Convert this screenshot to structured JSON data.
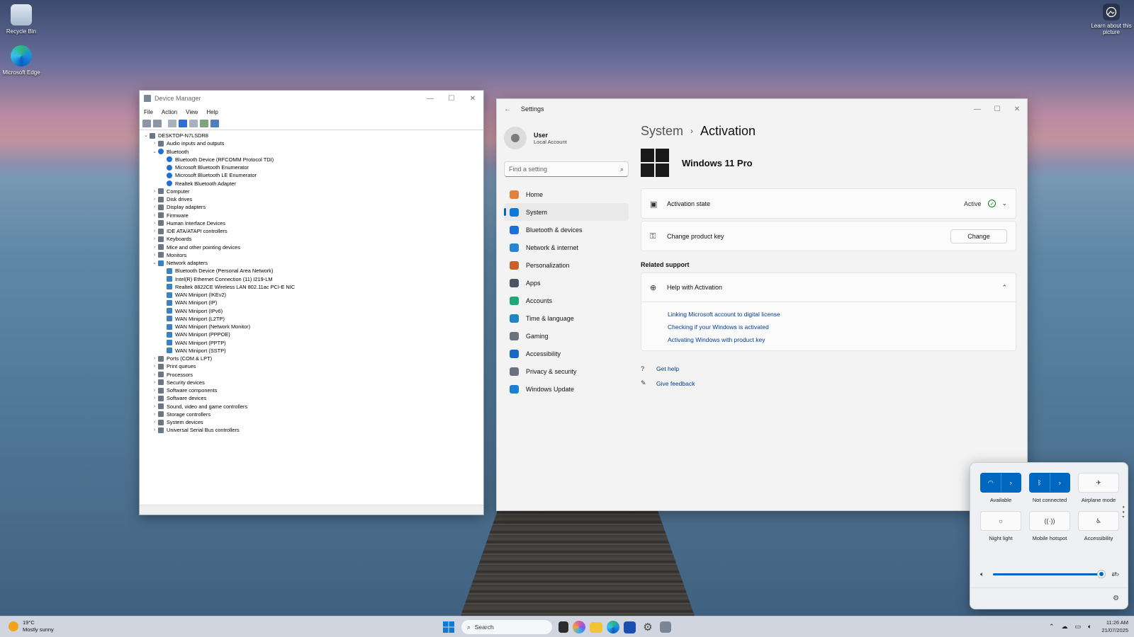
{
  "desktop": {
    "icons": [
      {
        "label": "Recycle Bin",
        "icon": "recycle-bin-icon"
      },
      {
        "label": "Microsoft Edge",
        "icon": "edge-icon"
      }
    ],
    "learn_label": "Learn about this picture"
  },
  "device_manager": {
    "title": "Device Manager",
    "menu": [
      "File",
      "Action",
      "View",
      "Help"
    ],
    "tree": [
      {
        "label": "DESKTOP-N7LSDR8",
        "level": 0,
        "expanded": true
      },
      {
        "label": "Audio inputs and outputs",
        "level": 1,
        "expanded": false
      },
      {
        "label": "Bluetooth",
        "level": 1,
        "expanded": true,
        "icon": "bt"
      },
      {
        "label": "Bluetooth Device (RFCOMM Protocol TDI)",
        "level": 2,
        "icon": "bt"
      },
      {
        "label": "Microsoft Bluetooth Enumerator",
        "level": 2,
        "icon": "bt"
      },
      {
        "label": "Microsoft Bluetooth LE Enumerator",
        "level": 2,
        "icon": "bt"
      },
      {
        "label": "Realtek Bluetooth Adapter",
        "level": 2,
        "icon": "bt"
      },
      {
        "label": "Computer",
        "level": 1,
        "expanded": false
      },
      {
        "label": "Disk drives",
        "level": 1,
        "expanded": false
      },
      {
        "label": "Display adapters",
        "level": 1,
        "expanded": false
      },
      {
        "label": "Firmware",
        "level": 1,
        "expanded": false
      },
      {
        "label": "Human Interface Devices",
        "level": 1,
        "expanded": false
      },
      {
        "label": "IDE ATA/ATAPI controllers",
        "level": 1,
        "expanded": false
      },
      {
        "label": "Keyboards",
        "level": 1,
        "expanded": false
      },
      {
        "label": "Mice and other pointing devices",
        "level": 1,
        "expanded": false
      },
      {
        "label": "Monitors",
        "level": 1,
        "expanded": false
      },
      {
        "label": "Network adapters",
        "level": 1,
        "expanded": true,
        "icon": "net"
      },
      {
        "label": "Bluetooth Device (Personal Area Network)",
        "level": 2,
        "icon": "net"
      },
      {
        "label": "Intel(R) Ethernet Connection (11) I219-LM",
        "level": 2,
        "icon": "net"
      },
      {
        "label": "Realtek 8822CE Wireless LAN 802.11ac PCI-E NIC",
        "level": 2,
        "icon": "net"
      },
      {
        "label": "WAN Miniport (IKEv2)",
        "level": 2,
        "icon": "net"
      },
      {
        "label": "WAN Miniport (IP)",
        "level": 2,
        "icon": "net"
      },
      {
        "label": "WAN Miniport (IPv6)",
        "level": 2,
        "icon": "net"
      },
      {
        "label": "WAN Miniport (L2TP)",
        "level": 2,
        "icon": "net"
      },
      {
        "label": "WAN Miniport (Network Monitor)",
        "level": 2,
        "icon": "net"
      },
      {
        "label": "WAN Miniport (PPPOE)",
        "level": 2,
        "icon": "net"
      },
      {
        "label": "WAN Miniport (PPTP)",
        "level": 2,
        "icon": "net"
      },
      {
        "label": "WAN Miniport (SSTP)",
        "level": 2,
        "icon": "net"
      },
      {
        "label": "Ports (COM & LPT)",
        "level": 1,
        "expanded": false
      },
      {
        "label": "Print queues",
        "level": 1,
        "expanded": false
      },
      {
        "label": "Processors",
        "level": 1,
        "expanded": false
      },
      {
        "label": "Security devices",
        "level": 1,
        "expanded": false
      },
      {
        "label": "Software components",
        "level": 1,
        "expanded": false
      },
      {
        "label": "Software devices",
        "level": 1,
        "expanded": false
      },
      {
        "label": "Sound, video and game controllers",
        "level": 1,
        "expanded": false
      },
      {
        "label": "Storage controllers",
        "level": 1,
        "expanded": false
      },
      {
        "label": "System devices",
        "level": 1,
        "expanded": false
      },
      {
        "label": "Universal Serial Bus controllers",
        "level": 1,
        "expanded": false
      }
    ]
  },
  "settings": {
    "title": "Settings",
    "user": {
      "name": "User",
      "account": "Local Account"
    },
    "search_placeholder": "Find a setting",
    "nav": [
      {
        "label": "Home",
        "icon": "home-icon",
        "color": "#e0823b",
        "selected": false
      },
      {
        "label": "System",
        "icon": "system-icon",
        "color": "#0f7bd6",
        "selected": true
      },
      {
        "label": "Bluetooth & devices",
        "icon": "bluetooth-icon",
        "color": "#1e6fd9",
        "selected": false
      },
      {
        "label": "Network & internet",
        "icon": "network-icon",
        "color": "#2a84d2",
        "selected": false
      },
      {
        "label": "Personalization",
        "icon": "brush-icon",
        "color": "#c8612c",
        "selected": false
      },
      {
        "label": "Apps",
        "icon": "apps-icon",
        "color": "#4b5563",
        "selected": false
      },
      {
        "label": "Accounts",
        "icon": "accounts-icon",
        "color": "#1fa67a",
        "selected": false
      },
      {
        "label": "Time & language",
        "icon": "globe-icon",
        "color": "#1c86c8",
        "selected": false
      },
      {
        "label": "Gaming",
        "icon": "gamepad-icon",
        "color": "#6b7280",
        "selected": false
      },
      {
        "label": "Accessibility",
        "icon": "accessibility-icon",
        "color": "#1769c4",
        "selected": false
      },
      {
        "label": "Privacy & security",
        "icon": "shield-icon",
        "color": "#6b7280",
        "selected": false
      },
      {
        "label": "Windows Update",
        "icon": "update-icon",
        "color": "#1c7fd4",
        "selected": false
      }
    ],
    "breadcrumb": {
      "parent": "System",
      "current": "Activation"
    },
    "product": "Windows 11 Pro",
    "activation_state": {
      "label": "Activation state",
      "value": "Active"
    },
    "product_key": {
      "label": "Change product key",
      "button": "Change"
    },
    "related_support": "Related support",
    "help": {
      "title": "Help with Activation",
      "links": [
        "Linking Microsoft account to digital license",
        "Checking if your Windows is activated",
        "Activating Windows with product key"
      ]
    },
    "get_help": "Get help",
    "give_feedback": "Give feedback"
  },
  "quick_settings": {
    "tiles": [
      {
        "label": "Available",
        "icon": "wifi-icon",
        "on": true
      },
      {
        "label": "Not connected",
        "icon": "bluetooth-icon",
        "on": true
      },
      {
        "label": "Airplane mode",
        "icon": "airplane-icon",
        "on": false
      },
      {
        "label": "Night light",
        "icon": "night-light-icon",
        "on": false
      },
      {
        "label": "Mobile hotspot",
        "icon": "hotspot-icon",
        "on": false
      },
      {
        "label": "Accessibility",
        "icon": "accessibility-icon",
        "on": false
      }
    ],
    "volume": 0.97
  },
  "taskbar": {
    "weather": {
      "temp": "19°C",
      "condition": "Mostly sunny"
    },
    "search_label": "Search",
    "time": "11:26 AM",
    "date": "21/07/2025"
  }
}
